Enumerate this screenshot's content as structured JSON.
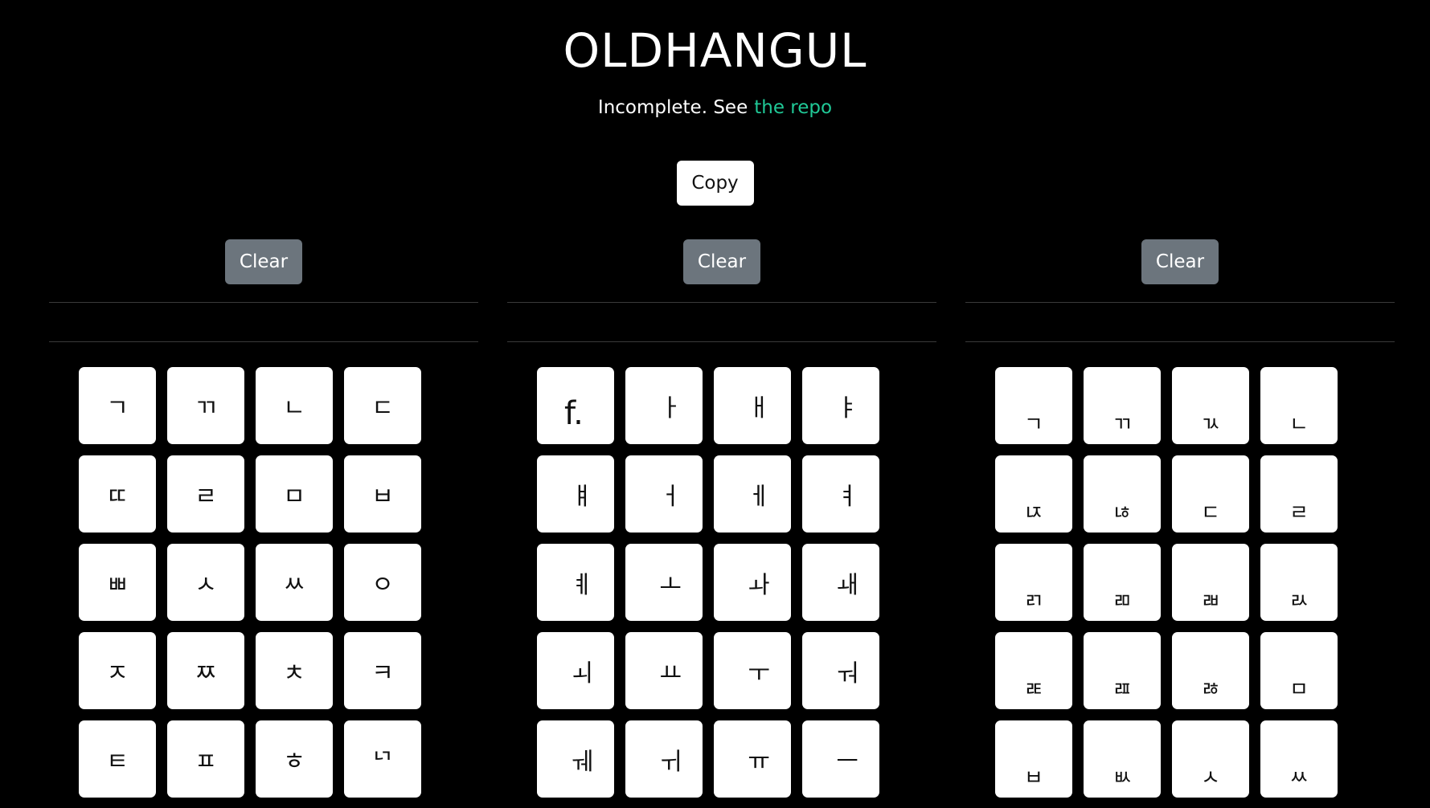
{
  "header": {
    "title": "OLDHANGUL",
    "subtitle_text": "Incomplete. See",
    "subtitle_link": "the repo",
    "link_color": "#20c997"
  },
  "toolbar": {
    "copy_label": "Copy"
  },
  "columns": [
    {
      "clear_label": "Clear",
      "keys": [
        "ㄱ",
        "ㄲ",
        "ㄴ",
        "ㄷ",
        "ㄸ",
        "ㄹ",
        "ㅁ",
        "ㅂ",
        "ㅃ",
        "ㅅ",
        "ㅆ",
        "ㅇ",
        "ㅈ",
        "ㅉ",
        "ㅊ",
        "ㅋ",
        "ㅌ",
        "ㅍ",
        "ㅎ",
        "ᄓ"
      ]
    },
    {
      "clear_label": "Clear",
      "keys": [
        "f.",
        "ㅏ",
        "ㅐ",
        "ㅑ",
        "ㅒ",
        "ㅓ",
        "ㅔ",
        "ㅕ",
        "ㅖ",
        "ㅗ",
        "ㅘ",
        "ㅙ",
        "ㅚ",
        "ㅛ",
        "ㅜ",
        "ㅝ",
        "ㅞ",
        "ㅟ",
        "ㅠ",
        "ㅡ"
      ]
    },
    {
      "clear_label": "Clear",
      "keys": [
        "ㄱ",
        "ㄲ",
        "ㄳ",
        "ㄴ",
        "ㄵ",
        "ㄶ",
        "ㄷ",
        "ㄹ",
        "ㄺ",
        "ㄻ",
        "ㄼ",
        "ㄽ",
        "ㄾ",
        "ㄿ",
        "ㅀ",
        "ㅁ",
        "ㅂ",
        "ㅄ",
        "ㅅ",
        "ㅆ"
      ]
    }
  ]
}
